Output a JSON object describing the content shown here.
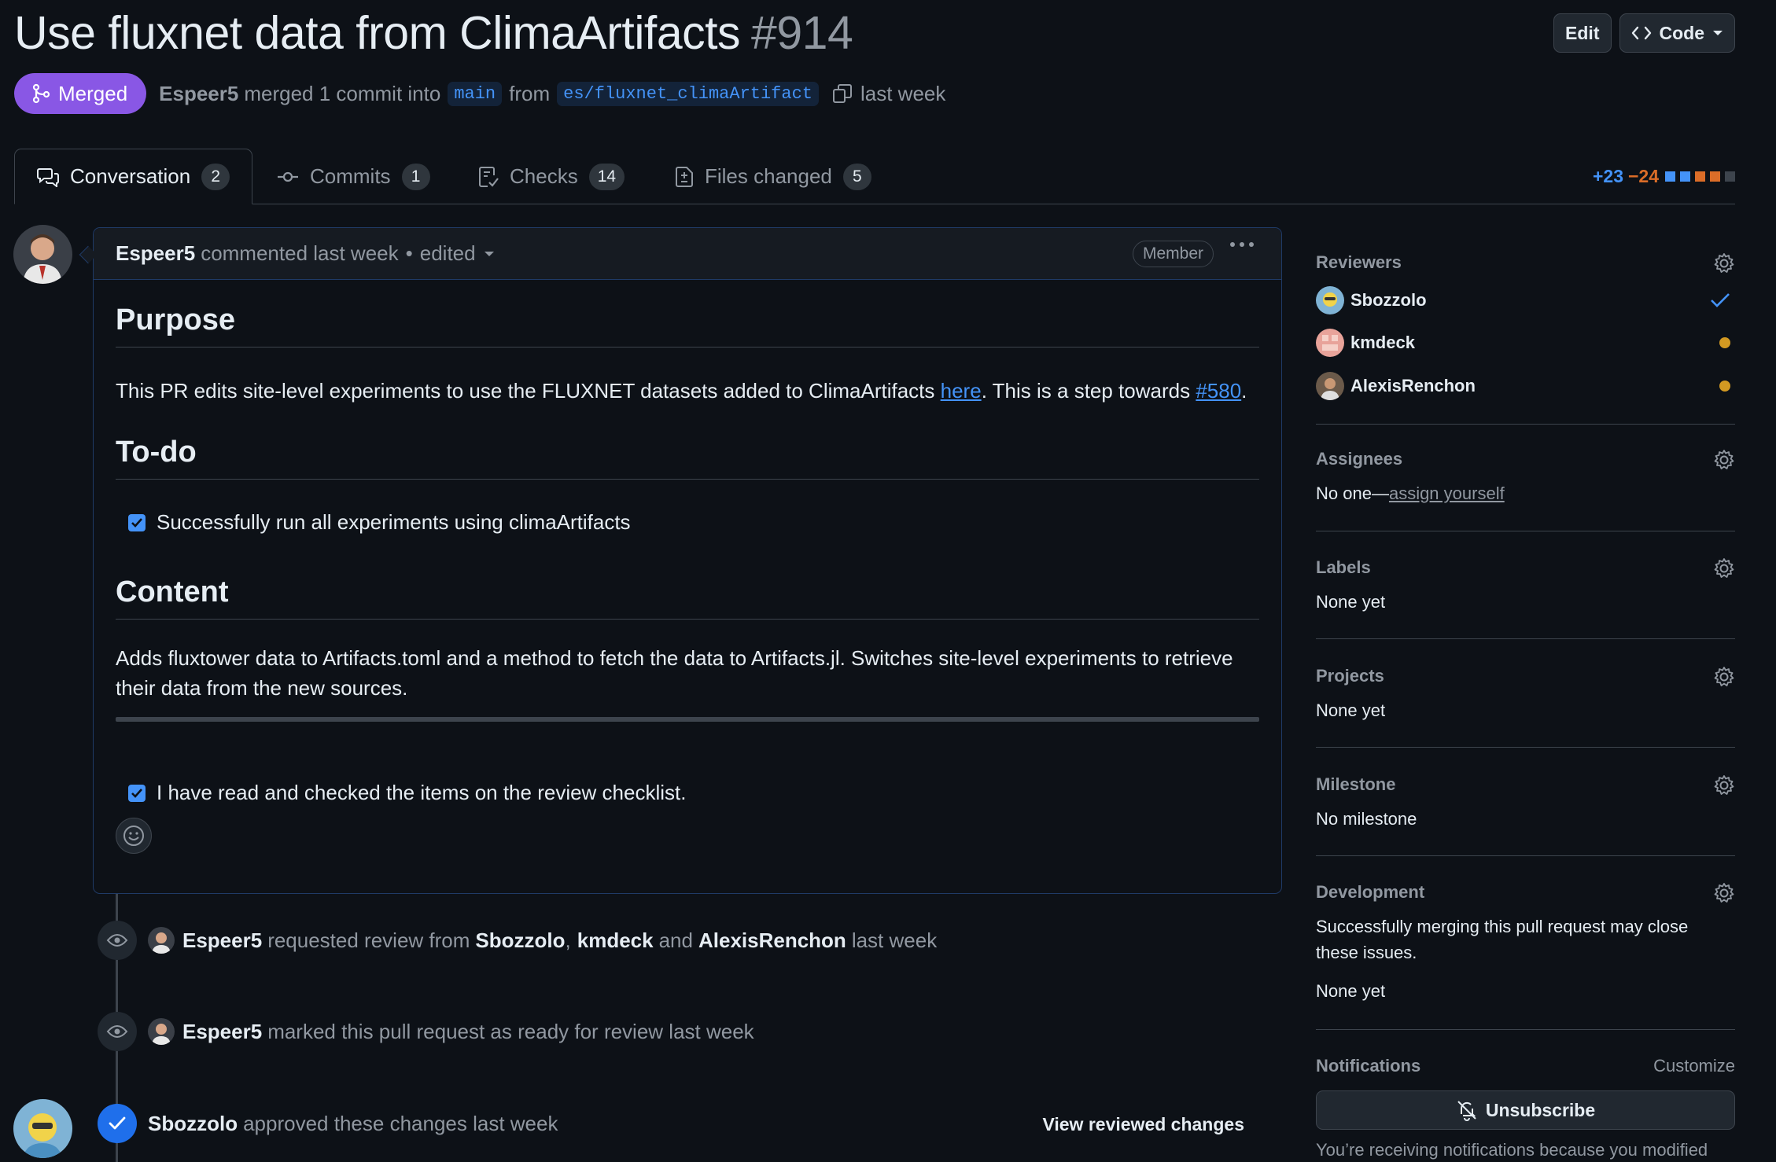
{
  "pr": {
    "title": "Use fluxnet data from ClimaArtifacts",
    "number": "#914",
    "state": "Merged",
    "author": "Espeer5",
    "action_text": "merged 1 commit into",
    "base_branch": "main",
    "from_text": "from",
    "head_branch": "es/fluxnet_climaArtifact",
    "time": "last week"
  },
  "header_buttons": {
    "edit": "Edit",
    "code": "Code"
  },
  "tabs": [
    {
      "label": "Conversation",
      "count": "2"
    },
    {
      "label": "Commits",
      "count": "1"
    },
    {
      "label": "Checks",
      "count": "14"
    },
    {
      "label": "Files changed",
      "count": "5"
    }
  ],
  "diffstat": {
    "additions": "+23",
    "deletions": "−24"
  },
  "comment": {
    "author": "Espeer5",
    "meta": "commented last week",
    "edited": "edited",
    "badge": "Member",
    "headings": {
      "purpose": "Purpose",
      "todo": "To-do",
      "content": "Content"
    },
    "purpose_text_1": "This PR edits site-level experiments to use the FLUXNET datasets added to ClimaArtifacts ",
    "purpose_link_1": "here",
    "purpose_text_2": ". This is a step towards ",
    "purpose_link_2": "#580",
    "purpose_text_3": ".",
    "todo_item": "Successfully run all experiments using climaArtifacts",
    "content_text": "Adds fluxtower data to Artifacts.toml and a method to fetch the data to Artifacts.jl. Switches site-level experiments to retrieve their data from the new sources.",
    "checklist_item": "I have read and checked the items on the review checklist."
  },
  "events": {
    "review_request": {
      "actor": "Espeer5",
      "text": "requested review from",
      "r1": "Sbozzolo",
      "comma": ",",
      "r2": "kmdeck",
      "and": "and",
      "r3": "AlexisRenchon",
      "time": "last week"
    },
    "ready": {
      "actor": "Espeer5",
      "text": "marked this pull request as ready for review last week"
    },
    "approved": {
      "actor": "Sbozzolo",
      "text": "approved these changes last week",
      "link": "View reviewed changes"
    }
  },
  "sidebar": {
    "reviewers_title": "Reviewers",
    "reviewers": [
      {
        "name": "Sbozzolo",
        "status": "approved"
      },
      {
        "name": "kmdeck",
        "status": "pending"
      },
      {
        "name": "AlexisRenchon",
        "status": "pending"
      }
    ],
    "assignees_title": "Assignees",
    "assignees_text": "No one—",
    "assignees_link": "assign yourself",
    "labels_title": "Labels",
    "labels_text": "None yet",
    "projects_title": "Projects",
    "projects_text": "None yet",
    "milestone_title": "Milestone",
    "milestone_text": "No milestone",
    "development_title": "Development",
    "development_text": "Successfully merging this pull request may close these issues.",
    "development_none": "None yet",
    "notifications_title": "Notifications",
    "customize": "Customize",
    "unsubscribe": "Unsubscribe",
    "notification_reason": "You’re receiving notifications because you modified"
  },
  "colors": {
    "merged": "#8957e5",
    "accent": "#4493f8",
    "pending": "#d29922",
    "deletions": "#db6d28"
  },
  "icons": [
    "git-merge-icon",
    "copy-icon",
    "code-icon",
    "comment-discussion-icon",
    "commit-icon",
    "checklist-icon",
    "file-diff-icon",
    "eye-icon",
    "check-icon",
    "gear-icon",
    "bell-slash-icon",
    "smiley-icon",
    "kebab-horizontal-icon"
  ]
}
